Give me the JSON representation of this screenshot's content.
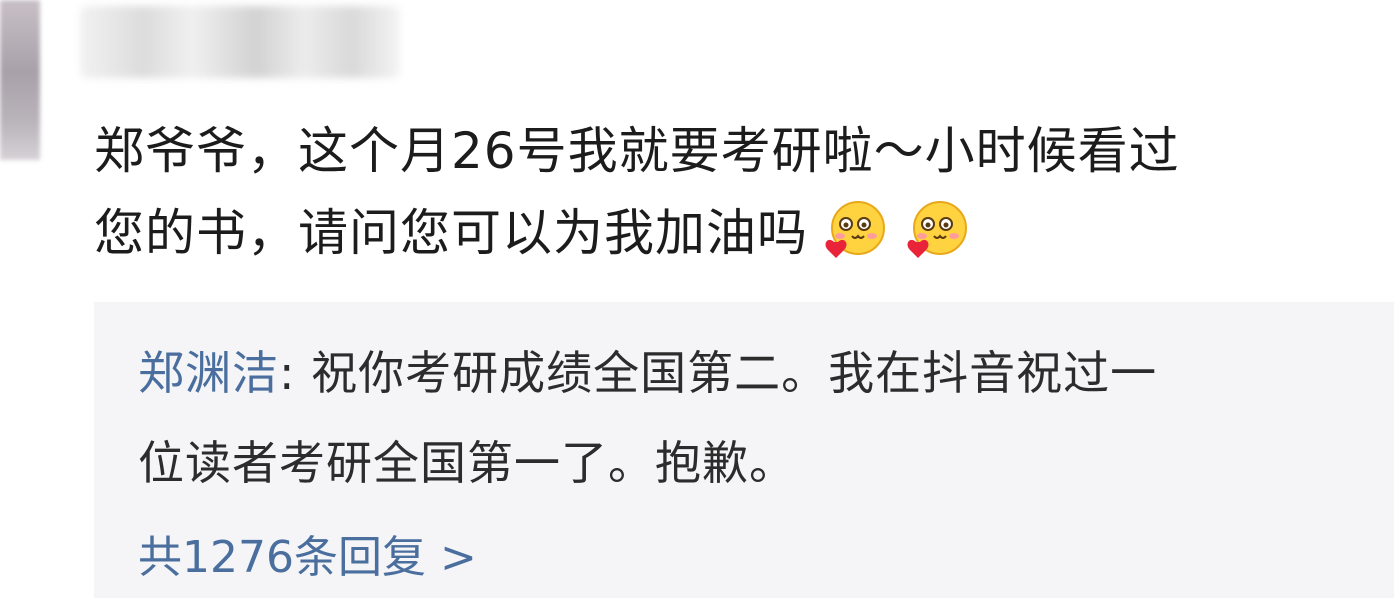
{
  "comment": {
    "line1": "郑爷爷，这个月26号我就要考研啦～小时候看过",
    "line2": "您的书，请问您可以为我加油吗",
    "emojis": [
      "hug-heart-emoji",
      "hug-heart-emoji"
    ]
  },
  "reply": {
    "author": "郑渊洁",
    "separator": ": ",
    "line1": "祝你考研成绩全国第二。我在抖音祝过一",
    "line2": "位读者考研全国第一了。抱歉。"
  },
  "replies_link": {
    "label": "共1276条回复 >"
  },
  "colors": {
    "link": "#4a6f9e",
    "text": "#1c1c1c",
    "reply_bg": "#f5f5f7"
  }
}
